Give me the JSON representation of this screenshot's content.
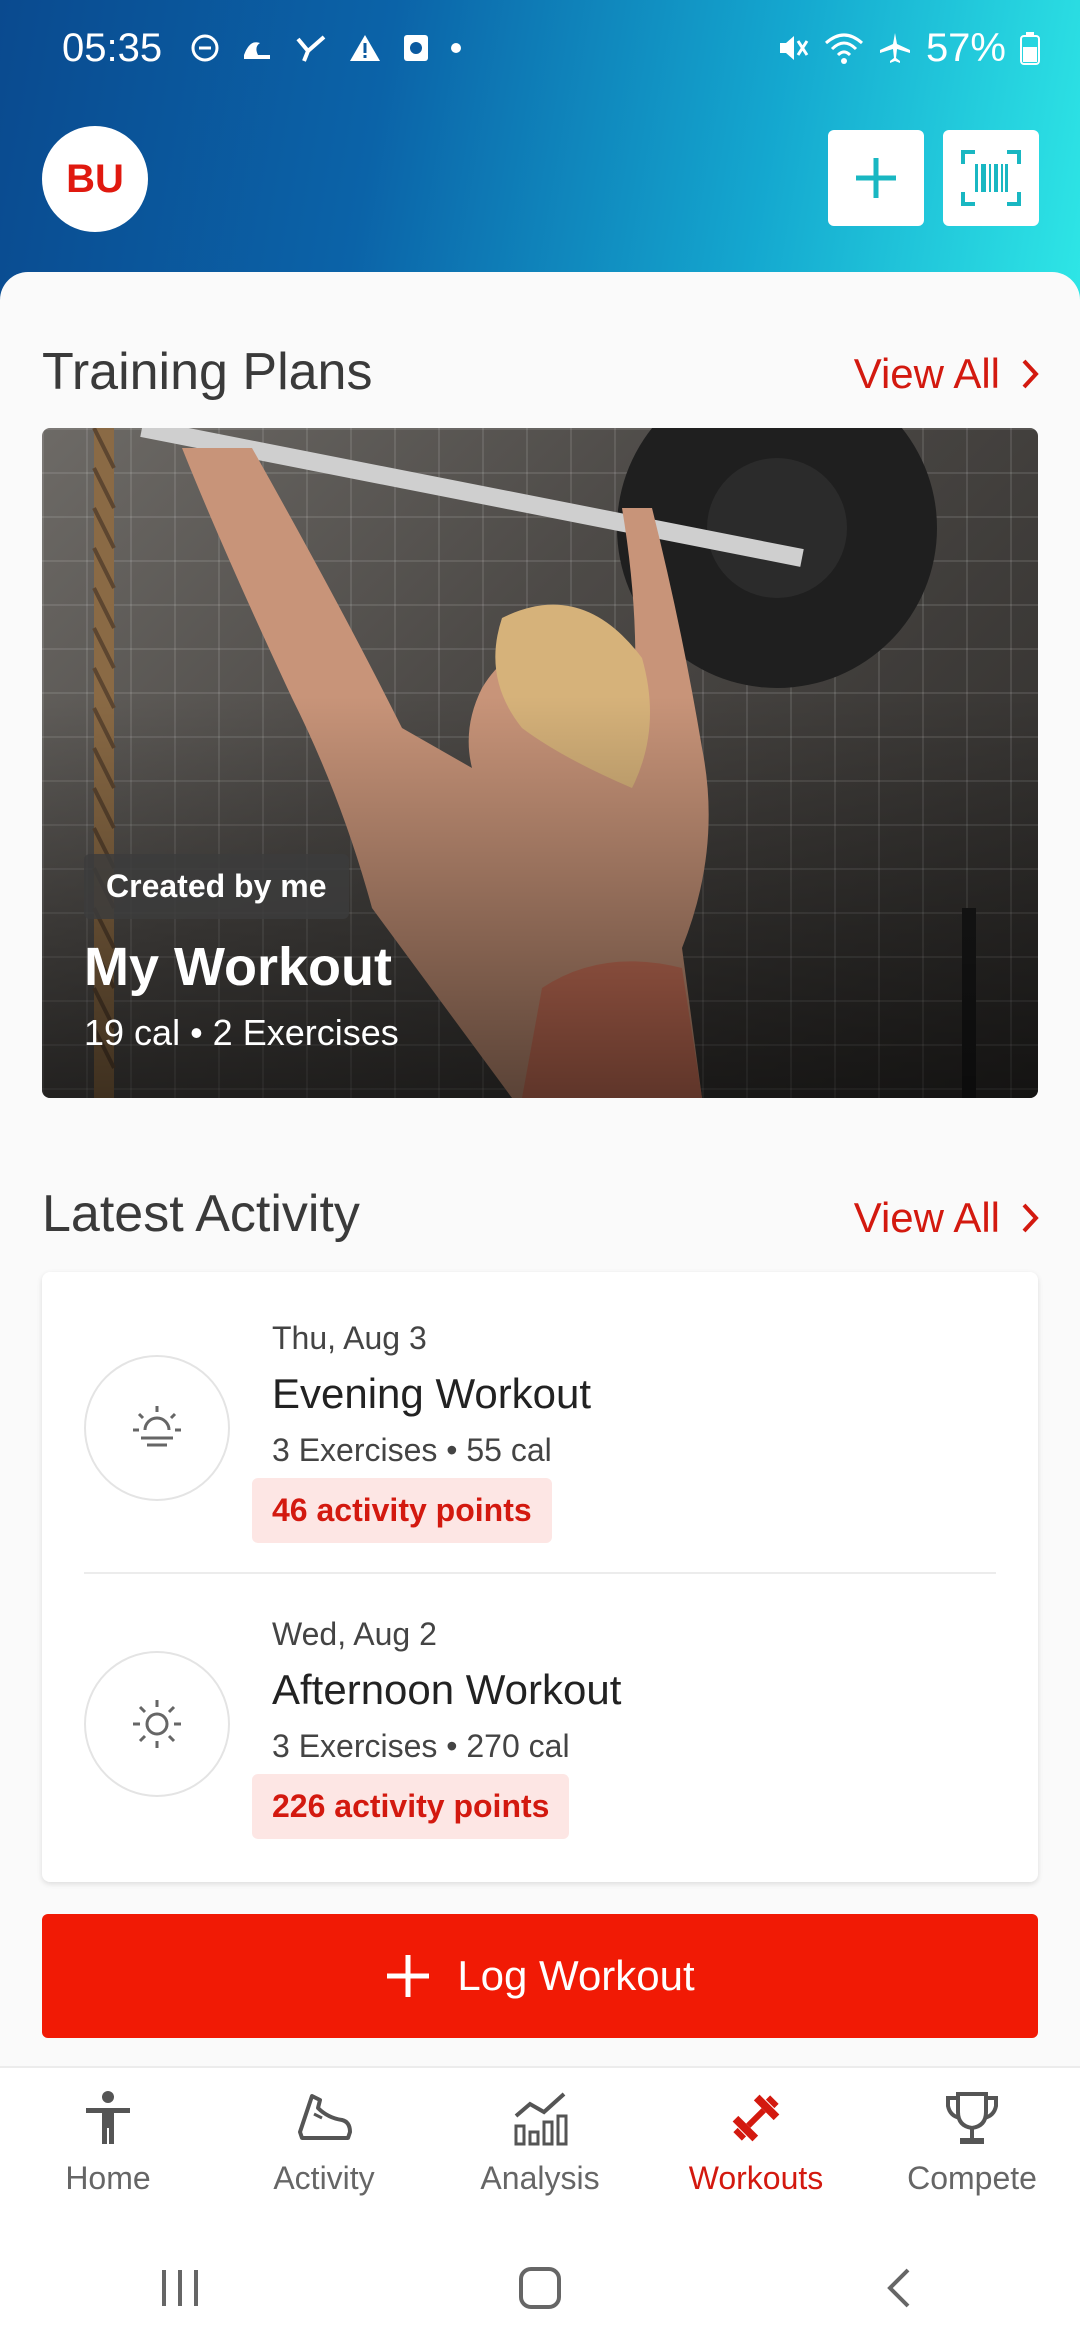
{
  "status_bar": {
    "time": "05:35",
    "battery": "57%"
  },
  "header": {
    "avatar_initials": "BU"
  },
  "training_plans": {
    "title": "Training Plans",
    "view_all": "View All",
    "card": {
      "badge": "Created by me",
      "name": "My Workout",
      "meta": "19 cal • 2 Exercises"
    }
  },
  "latest_activity": {
    "title": "Latest Activity",
    "view_all": "View All",
    "items": [
      {
        "date": "Thu, Aug 3",
        "name": "Evening Workout",
        "meta": "3 Exercises • 55 cal",
        "points": "46 activity points",
        "icon": "sunset-icon"
      },
      {
        "date": "Wed, Aug 2",
        "name": "Afternoon Workout",
        "meta": "3 Exercises • 270 cal",
        "points": "226 activity points",
        "icon": "sun-icon"
      }
    ]
  },
  "log_button": {
    "label": "Log Workout"
  },
  "bottom_nav": {
    "items": [
      {
        "label": "Home",
        "icon": "person-icon"
      },
      {
        "label": "Activity",
        "icon": "shoe-icon"
      },
      {
        "label": "Analysis",
        "icon": "chart-icon"
      },
      {
        "label": "Workouts",
        "icon": "dumbbell-icon"
      },
      {
        "label": "Compete",
        "icon": "trophy-icon"
      }
    ],
    "active_index": 3
  },
  "colors": {
    "accent": "#d3190f",
    "log_button": "#f11a05",
    "header_start": "#0a4a8f",
    "header_end": "#2ee6e6"
  }
}
